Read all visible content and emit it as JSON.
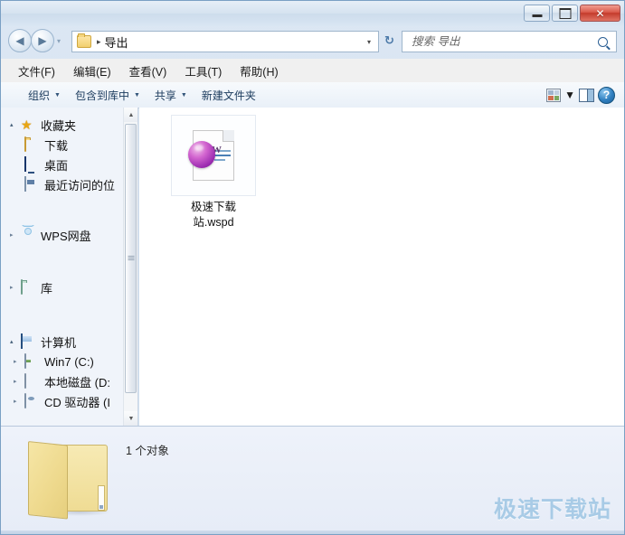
{
  "window": {
    "controls": {
      "minimize": "—",
      "maximize": "□",
      "close": "✕"
    }
  },
  "address": {
    "back_arrow": "◀",
    "forward_arrow": "▶",
    "history_caret": "▾",
    "folder_name": "导出",
    "separator": "▸",
    "dropdown_caret": "▾",
    "refresh": "↻"
  },
  "search": {
    "placeholder": "搜索 导出",
    "value": ""
  },
  "menubar": {
    "items": [
      {
        "label": "文件(F)"
      },
      {
        "label": "编辑(E)"
      },
      {
        "label": "查看(V)"
      },
      {
        "label": "工具(T)"
      },
      {
        "label": "帮助(H)"
      }
    ]
  },
  "toolbar": {
    "organize": "组织",
    "include_library": "包含到库中",
    "share": "共享",
    "new_folder": "新建文件夹",
    "caret": "▼",
    "view_caret": "▼",
    "help_glyph": "?"
  },
  "sidebar": {
    "items": [
      {
        "label": "收藏夹",
        "icon": "star-icon",
        "level": "root",
        "expander": "▴"
      },
      {
        "label": "下载",
        "icon": "folder-icon",
        "level": "child",
        "expander": ""
      },
      {
        "label": "桌面",
        "icon": "desktop-icon",
        "level": "child",
        "expander": ""
      },
      {
        "label": "最近访问的位",
        "icon": "recent-places-icon",
        "level": "child",
        "expander": ""
      },
      {
        "label": "WPS网盘",
        "icon": "cloud-icon",
        "level": "root",
        "expander": "▸"
      },
      {
        "label": "库",
        "icon": "library-icon",
        "level": "root",
        "expander": "▸"
      },
      {
        "label": "计算机",
        "icon": "computer-icon",
        "level": "root",
        "expander": "▴"
      },
      {
        "label": "Win7 (C:)",
        "icon": "harddisk-icon",
        "level": "child",
        "expander": "▸"
      },
      {
        "label": "本地磁盘 (D:",
        "icon": "disk-icon",
        "level": "child",
        "expander": "▸"
      },
      {
        "label": "CD 驱动器 (I",
        "icon": "cd-drive-icon",
        "level": "child",
        "expander": "▸"
      }
    ],
    "scroll_up": "▲",
    "scroll_down": "▼"
  },
  "content": {
    "files": [
      {
        "name_line1": "极速下载",
        "name_line2": "站.wspd",
        "icon": "wps-document-icon",
        "letter": "W"
      }
    ]
  },
  "details": {
    "object_count": "1 个对象",
    "folder_icon": "open-folder-icon"
  },
  "watermark": {
    "text": "极速下载站"
  },
  "colors": {
    "accent_blue": "#2b5f94",
    "watermark_blue": "#a8cbe6",
    "close_red": "#c43b2c",
    "folder_yellow": "#efdc94",
    "wps_purple": "#9b2bb0"
  }
}
